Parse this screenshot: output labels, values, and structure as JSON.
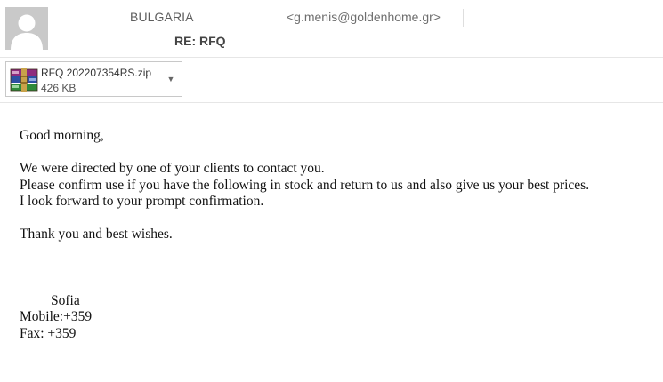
{
  "header": {
    "sender_name": "BULGARIA",
    "sender_email": "<g.menis@goldenhome.gr>",
    "subject": "RE: RFQ",
    "avatar_icon": "person-placeholder-icon"
  },
  "attachment": {
    "name": "RFQ 202207354RS.zip",
    "size": "426 KB",
    "icon": "winrar-archive-icon",
    "dropdown_icon": "chevron-down-icon"
  },
  "body": {
    "greeting": "Good morning,",
    "paragraph": [
      "We were directed by one of your clients to contact you.",
      "Please confirm use if you have the following in stock and return to us and also give us your best prices.",
      "I look forward to your prompt confirmation."
    ],
    "closing": "Thank you and best wishes.",
    "signature": {
      "name": "Sofia",
      "mobile": "Mobile:+359",
      "fax": "Fax: +359"
    }
  },
  "colors": {
    "avatar_bg": "#c9c9c9",
    "divider": "#e6e6e6",
    "attachment_border": "#c8c8c8"
  }
}
